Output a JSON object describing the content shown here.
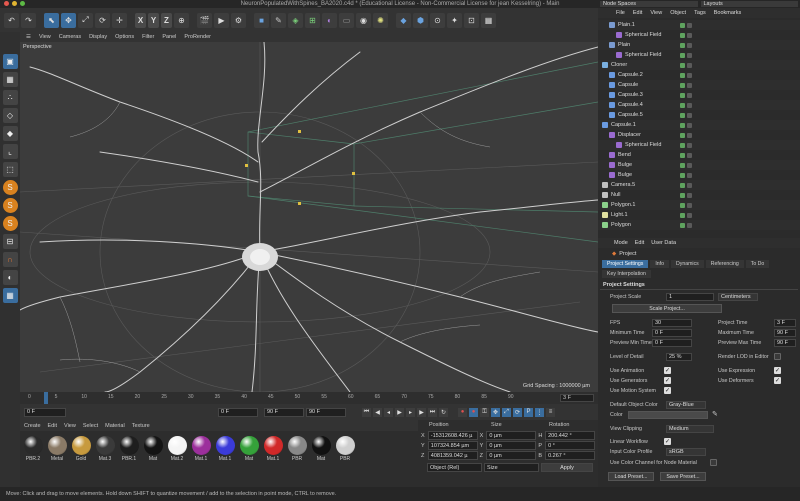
{
  "window": {
    "title": "NeuronPopulatedWithSpines_BA2020.c4d * (Educational License - Non-Commercial License for jean Kesselring) - Main"
  },
  "right_top": {
    "node_spaces": "Node Spaces",
    "layouts": "Layouts"
  },
  "viewport": {
    "menu": [
      "View",
      "Cameras",
      "Display",
      "Options",
      "Filter",
      "Panel",
      "ProRender"
    ],
    "camera_label": "Perspective",
    "grid_spacing": "Grid Spacing : 1000000 µm"
  },
  "timeline": {
    "ticks": [
      "0",
      "5",
      "10",
      "15",
      "20",
      "25",
      "30",
      "35",
      "40",
      "45",
      "50",
      "55",
      "60",
      "65",
      "70",
      "75",
      "80",
      "85",
      "90"
    ],
    "current_frame": "3 F",
    "start_field": "0 F",
    "start_field2": "0 F",
    "end_field": "90 F",
    "end_field2": "90 F"
  },
  "materials": {
    "menu": [
      "Create",
      "Edit",
      "View",
      "Select",
      "Material",
      "Texture"
    ],
    "items": [
      {
        "name": "PBR.2",
        "color": "#2a2a2a"
      },
      {
        "name": "Metal",
        "color": "#8a7a66"
      },
      {
        "name": "Gold",
        "color": "#c79a3e"
      },
      {
        "name": "Mat.3",
        "color": "#3a3a3a"
      },
      {
        "name": "PBR.1",
        "color": "#1e1e1e"
      },
      {
        "name": "Mat",
        "color": "#141414"
      },
      {
        "name": "Mat.2",
        "color": "#f4f4f4"
      },
      {
        "name": "Mat.1",
        "color": "#9c2f9c"
      },
      {
        "name": "Mat.1",
        "color": "#3b3bd9"
      },
      {
        "name": "Mat",
        "color": "#35a13a"
      },
      {
        "name": "Mat.1",
        "color": "#d12929"
      },
      {
        "name": "PBR",
        "color": "#888888"
      },
      {
        "name": "Mat",
        "color": "#111111"
      },
      {
        "name": "PBR",
        "color": "#cfcfcf"
      }
    ]
  },
  "coordinates": {
    "headers": {
      "position": "Position",
      "size": "Size",
      "rotation": "Rotation"
    },
    "rows": [
      {
        "axis": "X",
        "position": "-15312608.426 µ",
        "size": "0 µm",
        "rot_axis": "H",
        "rotation": "200.442 °"
      },
      {
        "axis": "Y",
        "position": "107324.854 µm",
        "size": "0 µm",
        "rot_axis": "P",
        "rotation": "0 °"
      },
      {
        "axis": "Z",
        "position": "4081359.042 µ",
        "size": "0 µm",
        "rot_axis": "B",
        "rotation": "0.267 °"
      }
    ],
    "mode": "Object (Rel)",
    "size_mode": "Size",
    "apply": "Apply"
  },
  "objects": {
    "menu": [
      "File",
      "Edit",
      "View",
      "Object",
      "Tags",
      "Bookmarks"
    ],
    "items": [
      {
        "name": "Plain.1",
        "indent": 1,
        "color": "#7a9bd0"
      },
      {
        "name": "Spherical Field",
        "indent": 2,
        "color": "#9a6bd0"
      },
      {
        "name": "Plain",
        "indent": 1,
        "color": "#7a9bd0"
      },
      {
        "name": "Spherical Field",
        "indent": 2,
        "color": "#9a6bd0"
      },
      {
        "name": "Cloner",
        "indent": 0,
        "color": "#7ab0e0"
      },
      {
        "name": "Capsule.2",
        "indent": 1,
        "color": "#6a9ae0"
      },
      {
        "name": "Capsule",
        "indent": 1,
        "color": "#6a9ae0"
      },
      {
        "name": "Capsule.3",
        "indent": 1,
        "color": "#6a9ae0"
      },
      {
        "name": "Capsule.4",
        "indent": 1,
        "color": "#6a9ae0"
      },
      {
        "name": "Capsule.5",
        "indent": 1,
        "color": "#6a9ae0"
      },
      {
        "name": "Capsule.1",
        "indent": 0,
        "color": "#6a9ae0"
      },
      {
        "name": "Displacer",
        "indent": 1,
        "color": "#9a6bd0"
      },
      {
        "name": "Spherical Field",
        "indent": 2,
        "color": "#9a6bd0"
      },
      {
        "name": "Bend",
        "indent": 1,
        "color": "#9a6bd0"
      },
      {
        "name": "Bulge",
        "indent": 1,
        "color": "#9a6bd0"
      },
      {
        "name": "Bulge",
        "indent": 1,
        "color": "#9a6bd0"
      },
      {
        "name": "Camera.5",
        "indent": 0,
        "color": "#c0c0c0"
      },
      {
        "name": "Null",
        "indent": 0,
        "color": "#c0c0c0"
      },
      {
        "name": "Polygon.1",
        "indent": 0,
        "color": "#8ad08a"
      },
      {
        "name": "Light.1",
        "indent": 0,
        "color": "#e0e0a0"
      },
      {
        "name": "Polygon",
        "indent": 0,
        "color": "#8ad08a"
      }
    ]
  },
  "attributes": {
    "menu": [
      "Mode",
      "Edit",
      "User Data"
    ],
    "title": "Project",
    "tabs": [
      "Project Settings",
      "Info",
      "Dynamics",
      "Referencing",
      "To Do",
      "Key Interpolation"
    ],
    "section": "Project Settings",
    "project_scale_label": "Project Scale",
    "project_scale_value": "1",
    "project_scale_unit": "Centimeters",
    "scale_project_button": "Scale Project...",
    "fps_label": "FPS",
    "fps": "30",
    "project_time_label": "Project Time",
    "project_time": "3 F",
    "min_time_label": "Minimum Time",
    "min_time": "0 F",
    "max_time_label": "Maximum Time",
    "max_time": "90 F",
    "preview_min_label": "Preview Min Time",
    "preview_min": "0 F",
    "preview_max_label": "Preview Max Time",
    "preview_max": "90 F",
    "lod_label": "Level of Detail",
    "lod": "25 %",
    "render_lod_label": "Render LOD in Editor",
    "use_animation": "Use Animation",
    "use_expression": "Use Expression",
    "use_generators": "Use Generators",
    "use_deformers": "Use Deformers",
    "use_motion": "Use Motion System",
    "default_color_label": "Default Object Color",
    "default_color": "Gray-Blue",
    "color_label": "Color",
    "view_clipping_label": "View Clipping",
    "view_clipping": "Medium",
    "linear_workflow": "Linear Workflow",
    "input_profile_label": "Input Color Profile",
    "input_profile": "sRGB",
    "color_channel_label": "Use Color Channel for Node Material",
    "load_preset": "Load Preset...",
    "save_preset": "Save Preset..."
  },
  "status": "Move: Click and drag to move elements. Hold down SHIFT to quantize movement / add to the selection in point mode, CTRL to remove."
}
